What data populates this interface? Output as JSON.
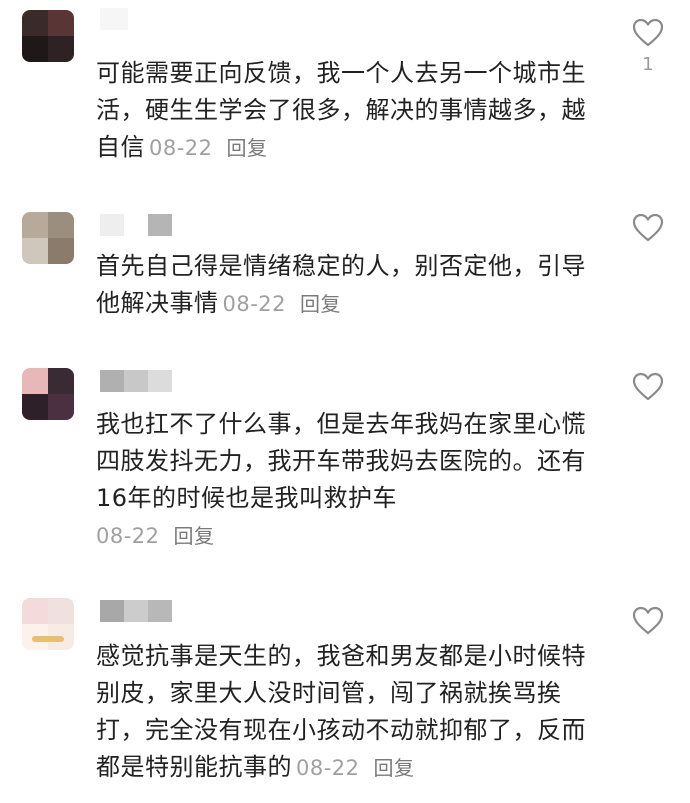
{
  "comments": [
    {
      "id": "c1",
      "text": "可能需要正向反馈，我一个人去另一个城市生活，硬生生学会了很多，解决的事情越多，越自信",
      "date": "08-22",
      "reply": "回复",
      "like_count": "1",
      "like_icon": "heart-icon"
    },
    {
      "id": "c2",
      "text": "首先自己得是情绪稳定的人，别否定他，引导他解决事情",
      "date": "08-22",
      "reply": "回复",
      "like_count": "",
      "like_icon": "heart-icon"
    },
    {
      "id": "c3",
      "text": "我也扛不了什么事，但是去年我妈在家里心慌四肢发抖无力，我开车带我妈去医院的。还有16年的时候也是我叫救护车",
      "date": "08-22",
      "reply": "回复",
      "like_count": "",
      "like_icon": "heart-icon"
    },
    {
      "id": "c4",
      "text": "感觉抗事是天生的，我爸和男友都是小时候特别皮，家里大人没时间管，闯了祸就挨骂挨打，完全没有现在小孩动不动就抑郁了，反而都是特别能抗事的",
      "date": "08-22",
      "reply": "回复",
      "like_count": "",
      "like_icon": "heart-icon"
    }
  ],
  "colors": {
    "text": "#222222",
    "date": "#a0a0a0",
    "reply": "#7a7a7a",
    "heart_stroke": "#8a8a8a"
  }
}
